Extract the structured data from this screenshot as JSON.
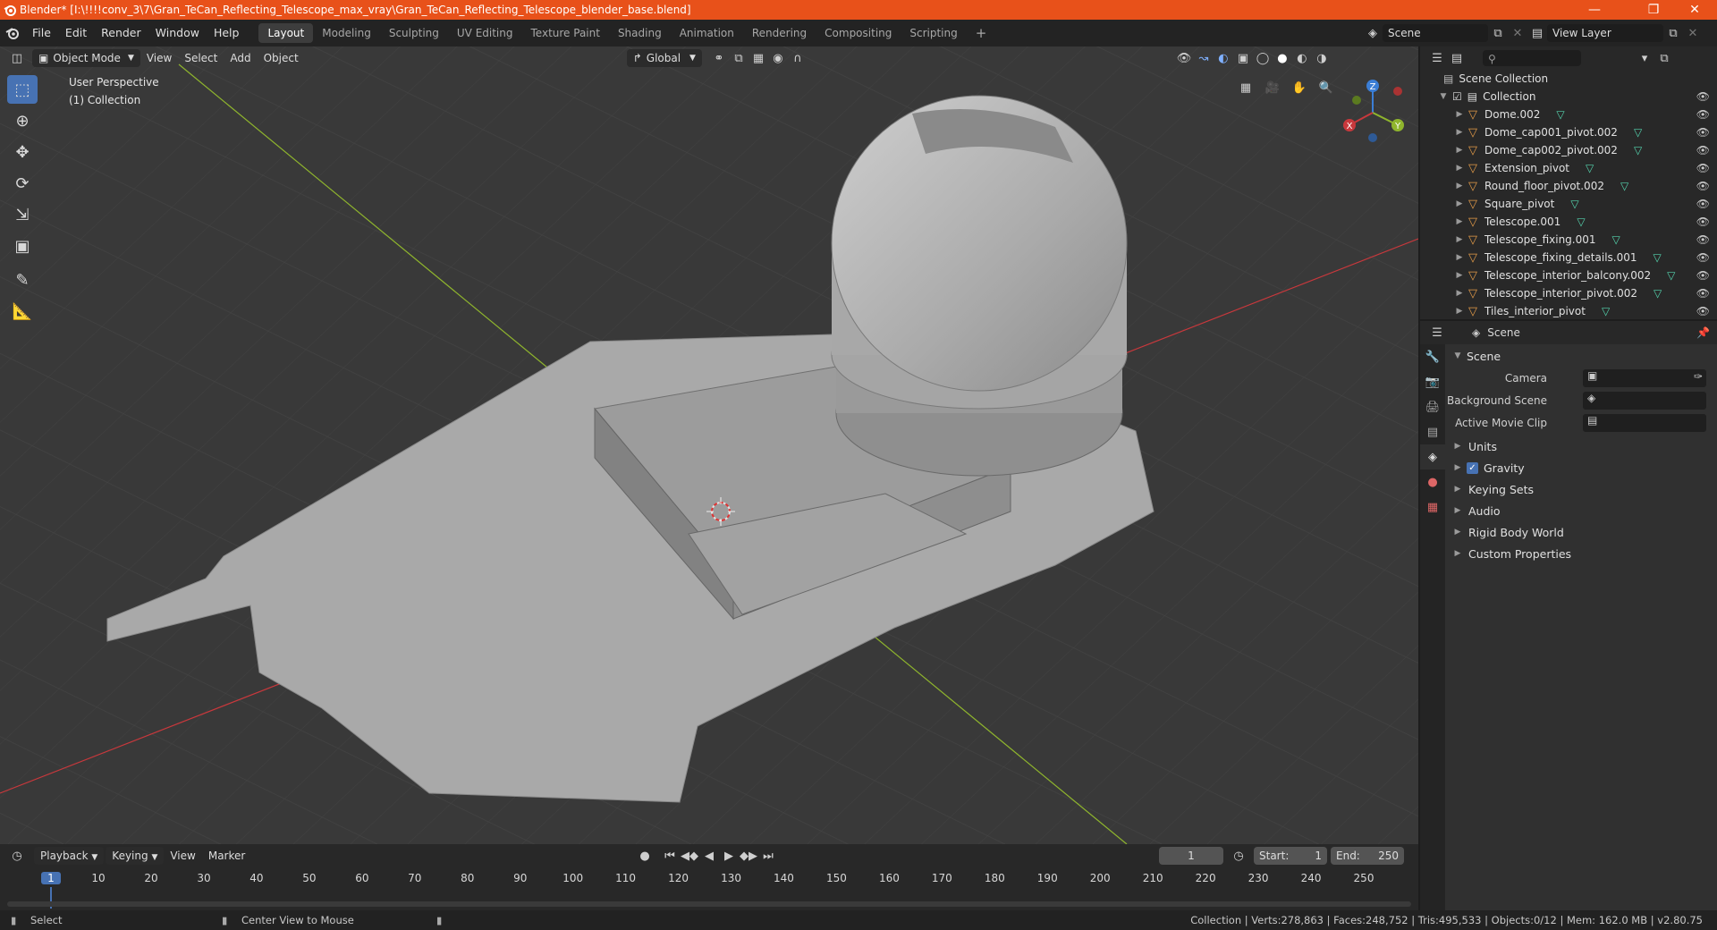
{
  "window": {
    "title": "Blender* [I:\\!!!!conv_3\\7\\Gran_TeCan_Reflecting_Telescope_max_vray\\Gran_TeCan_Reflecting_Telescope_blender_base.blend]"
  },
  "menu": [
    "File",
    "Edit",
    "Render",
    "Window",
    "Help"
  ],
  "workspaces": [
    "Layout",
    "Modeling",
    "Sculpting",
    "UV Editing",
    "Texture Paint",
    "Shading",
    "Animation",
    "Rendering",
    "Compositing",
    "Scripting"
  ],
  "topright": {
    "scene": "Scene",
    "view_layer": "View Layer"
  },
  "viewport": {
    "mode": "Object Mode",
    "menus": [
      "View",
      "Select",
      "Add",
      "Object"
    ],
    "transform_orientation": "Global",
    "info_line1": "User Perspective",
    "info_line2": "(1) Collection",
    "gizmo": {
      "x": "X",
      "y": "Y",
      "z": "Z"
    }
  },
  "outliner": {
    "root": "Scene Collection",
    "collection": "Collection",
    "items": [
      "Dome.002",
      "Dome_cap001_pivot.002",
      "Dome_cap002_pivot.002",
      "Extension_pivot",
      "Round_floor_pivot.002",
      "Square_pivot",
      "Telescope.001",
      "Telescope_fixing.001",
      "Telescope_fixing_details.001",
      "Telescope_interior_balcony.002",
      "Telescope_interior_pivot.002",
      "Tiles_interior_pivot"
    ]
  },
  "properties": {
    "header": "Scene",
    "panel_title": "Scene",
    "fields": [
      "Camera",
      "Background Scene",
      "Active Movie Clip"
    ],
    "sections": [
      "Units",
      "Gravity",
      "Keying Sets",
      "Audio",
      "Rigid Body World",
      "Custom Properties"
    ],
    "gravity_checked": true
  },
  "timeline": {
    "menus": [
      "Playback",
      "Keying",
      "View",
      "Marker"
    ],
    "current_frame": "1",
    "start_label": "Start:",
    "start": "1",
    "end_label": "End:",
    "end": "250",
    "ticks": [
      "1",
      "10",
      "20",
      "30",
      "40",
      "50",
      "60",
      "70",
      "80",
      "90",
      "100",
      "110",
      "120",
      "130",
      "140",
      "150",
      "160",
      "170",
      "180",
      "190",
      "200",
      "210",
      "220",
      "230",
      "240",
      "250"
    ]
  },
  "status": {
    "left": "Select",
    "middle": "Center View to Mouse",
    "right": "Collection | Verts:278,863 | Faces:248,752 | Tris:495,533 | Objects:0/12 | Mem: 162.0 MB | v2.80.75"
  },
  "colors": {
    "titlebar": "#e8511a",
    "active_blue": "#4772b3",
    "object_orange": "#e39b48",
    "mesh_teal": "#55d3ae",
    "axis_red": "#c8383c",
    "axis_green": "#8fb52d"
  }
}
